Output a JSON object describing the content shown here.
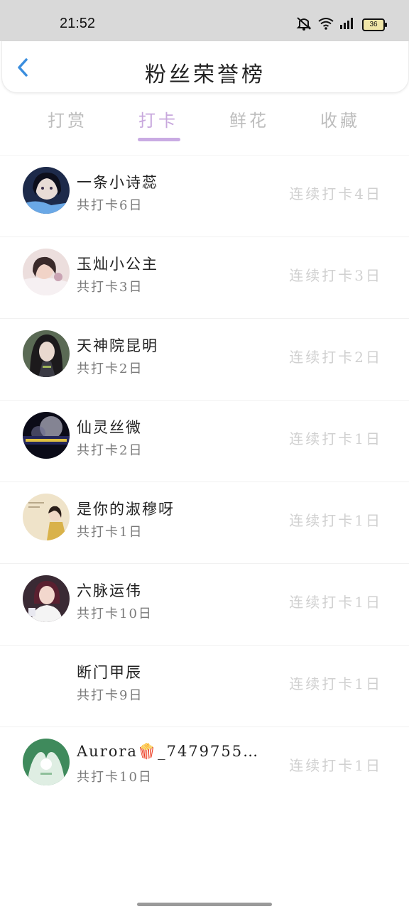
{
  "status_bar": {
    "time": "21:52",
    "battery": "36"
  },
  "header": {
    "title": "粉丝荣誉榜"
  },
  "tabs": [
    {
      "label": "打赏",
      "active": false
    },
    {
      "label": "打卡",
      "active": true
    },
    {
      "label": "鲜花",
      "active": false
    },
    {
      "label": "收藏",
      "active": false
    }
  ],
  "fans": [
    {
      "name": "一条小诗蕊",
      "total": "共打卡6日",
      "streak": "连续打卡4日",
      "avatar": "avatar-1"
    },
    {
      "name": "玉灿小公主",
      "total": "共打卡3日",
      "streak": "连续打卡3日",
      "avatar": "avatar-2"
    },
    {
      "name": "天神院昆明",
      "total": "共打卡2日",
      "streak": "连续打卡2日",
      "avatar": "avatar-3"
    },
    {
      "name": "仙灵丝微",
      "total": "共打卡2日",
      "streak": "连续打卡1日",
      "avatar": "avatar-4"
    },
    {
      "name": "是你的淑穆呀",
      "total": "共打卡1日",
      "streak": "连续打卡1日",
      "avatar": "avatar-5"
    },
    {
      "name": "六脉运伟",
      "total": "共打卡10日",
      "streak": "连续打卡1日",
      "avatar": "avatar-6"
    },
    {
      "name": "断门甲辰",
      "total": "共打卡9日",
      "streak": "连续打卡1日",
      "avatar": null
    },
    {
      "name": "Aurora🍿_74797550 …",
      "total": "共打卡10日",
      "streak": "连续打卡1日",
      "avatar": "avatar-8"
    }
  ],
  "colors": {
    "accent": "#c9abe3",
    "back": "#3b8ede",
    "muted": "#d0d0d0"
  },
  "icons": [
    "mute-icon",
    "wifi-icon",
    "signal-icon",
    "battery-icon",
    "back-arrow-icon"
  ]
}
